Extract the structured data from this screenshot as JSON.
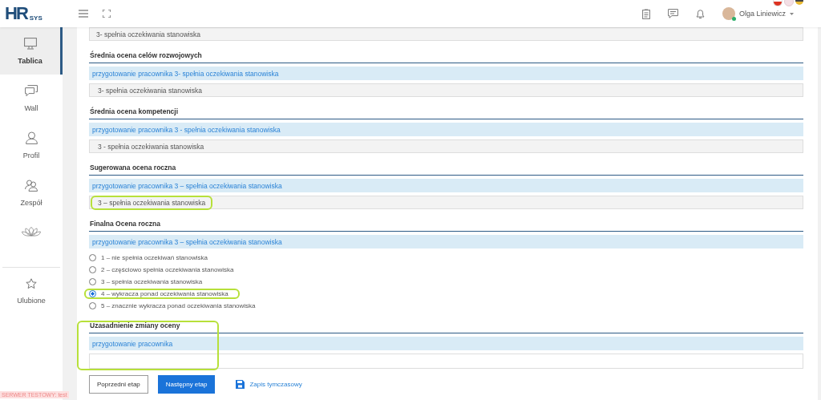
{
  "logo": {
    "mark": "HR",
    "suffix": "SYS"
  },
  "user": {
    "name": "Olga Liniewicz"
  },
  "sidebar": {
    "items": [
      {
        "label": "Tablica",
        "selected": true
      },
      {
        "label": "Wall",
        "selected": false
      },
      {
        "label": "Profil",
        "selected": false
      },
      {
        "label": "Zespół",
        "selected": false
      },
      {
        "selected": false
      }
    ],
    "favorites": {
      "label": "Ulubione"
    },
    "server_badge": "SERWER TESTOWY: test"
  },
  "top_value": "3- spełnia oczekiwania stanowiska",
  "sections": [
    {
      "title": "Średnia ocena celów rozwojowych",
      "hint": "przygotowanie pracownika 3- spełnia oczekiwania stanowiska",
      "value": "3- spełnia oczekiwania stanowiska",
      "highlighted": false
    },
    {
      "title": "Średnia ocena kompetencji",
      "hint": "przygotowanie pracownika 3 - spełnia oczekiwania stanowiska",
      "value": "3 - spełnia oczekiwania stanowiska",
      "highlighted": false
    },
    {
      "title": "Sugerowana ocena roczna",
      "hint": "przygotowanie pracownika 3 – spełnia oczekiwania stanowiska",
      "value": "3 – spełnia oczekiwania stanowiska",
      "highlighted": true
    }
  ],
  "final": {
    "title": "Finalna Ocena roczna",
    "hint": "przygotowanie pracownika 3 – spełnia oczekiwania stanowiska",
    "options": [
      {
        "label": "1 – nie spełnia oczekiwań stanowiska",
        "selected": false,
        "highlighted": false
      },
      {
        "label": "2 – częściowo spełnia oczekiwania stanowiska",
        "selected": false,
        "highlighted": false
      },
      {
        "label": "3 – spełnia oczekiwania stanowiska",
        "selected": false,
        "highlighted": false
      },
      {
        "label": "4 – wykracza ponad oczekiwania stanowiska",
        "selected": true,
        "highlighted": true
      },
      {
        "label": "5 – znacznie wykracza ponad oczekiwania stanowiska",
        "selected": false,
        "highlighted": false
      }
    ]
  },
  "justification": {
    "title": "Uzasadnienie zmiany oceny",
    "hint": "przygotowanie pracownika",
    "highlighted": true
  },
  "buttons": [
    {
      "label": "Poprzedni etap",
      "kind": "secondary"
    },
    {
      "label": "Następny etap",
      "kind": "primary"
    },
    {
      "label": "Zapis tymczasowy",
      "kind": "save"
    }
  ]
}
